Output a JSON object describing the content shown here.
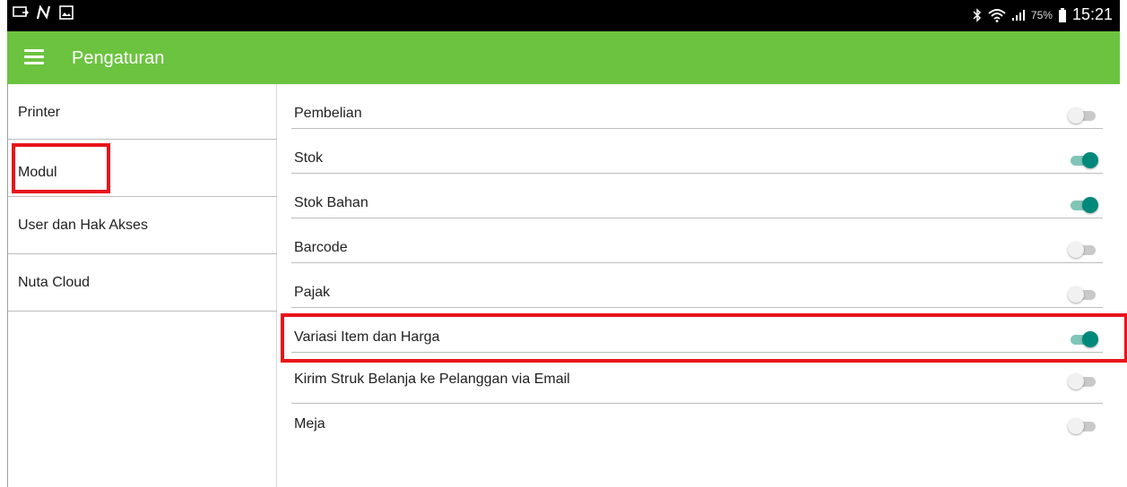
{
  "status_bar": {
    "left_icons": [
      "cast-icon",
      "nfc-n-icon",
      "gallery-icon"
    ],
    "battery_percent": "75%",
    "time": "15:21"
  },
  "app_bar": {
    "title": "Pengaturan"
  },
  "sidebar": {
    "items": [
      {
        "label": "Printer"
      },
      {
        "label": "Modul"
      },
      {
        "label": "User dan Hak Akses"
      },
      {
        "label": "Nuta Cloud"
      }
    ]
  },
  "modules": [
    {
      "label": "Pembelian",
      "enabled": false
    },
    {
      "label": "Stok",
      "enabled": true
    },
    {
      "label": "Stok Bahan",
      "enabled": true
    },
    {
      "label": "Barcode",
      "enabled": false
    },
    {
      "label": "Pajak",
      "enabled": false
    },
    {
      "label": "Variasi Item dan Harga",
      "enabled": true
    },
    {
      "label": "Kirim Struk Belanja ke Pelanggan via Email",
      "enabled": false
    },
    {
      "label": "Meja",
      "enabled": false
    }
  ],
  "colors": {
    "app_bar": "#6cc33f",
    "toggle_on": "#00897b",
    "highlight": "#e8141a"
  }
}
